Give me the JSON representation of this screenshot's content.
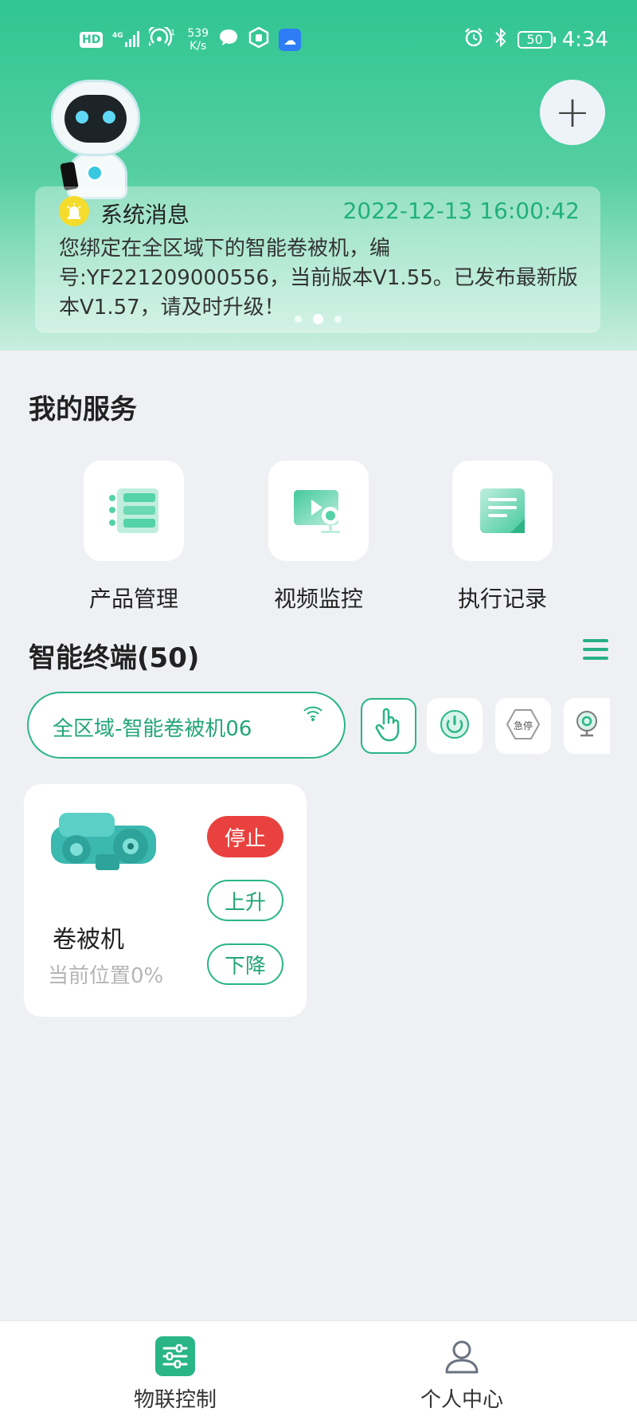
{
  "status_bar": {
    "hd": "HD",
    "network": "4G",
    "hotspot_count": "1",
    "net_speed_value": "539",
    "net_speed_unit": "K/s",
    "battery": "50",
    "time": "4:34"
  },
  "system_message": {
    "title": "系统消息",
    "timestamp": "2022-12-13 16:00:42",
    "text": "您绑定在全区域下的智能卷被机，编号:YF221209000556，当前版本V1.55。已发布最新版本V1.57，请及时升级！",
    "carousel_total": 3,
    "carousel_active": 2
  },
  "services": {
    "title": "我的服务",
    "items": [
      {
        "label": "产品管理",
        "icon": "product-management-icon"
      },
      {
        "label": "视频监控",
        "icon": "video-monitor-icon"
      },
      {
        "label": "执行记录",
        "icon": "execution-record-icon"
      }
    ]
  },
  "terminals": {
    "title": "智能终端(50)",
    "selected_device": "全区域-智能卷被机06",
    "quick_actions": [
      {
        "icon": "touch-control-icon",
        "selected": true
      },
      {
        "icon": "power-icon",
        "selected": false
      },
      {
        "label": "急停",
        "icon": "emergency-stop-icon",
        "selected": false
      },
      {
        "icon": "camera-icon",
        "selected": false
      }
    ]
  },
  "device_card": {
    "name": "卷被机",
    "position": "当前位置0%",
    "stop_label": "停止",
    "up_label": "上升",
    "down_label": "下降"
  },
  "tab_bar": {
    "tabs": [
      {
        "label": "物联控制",
        "icon": "control-panel-icon",
        "active": true
      },
      {
        "label": "个人中心",
        "icon": "user-icon",
        "active": false
      }
    ]
  },
  "colors": {
    "accent": "#29b586",
    "stop": "#e9413e",
    "header_gradient_top": "#2fc592",
    "timestamp": "#20b07d"
  }
}
